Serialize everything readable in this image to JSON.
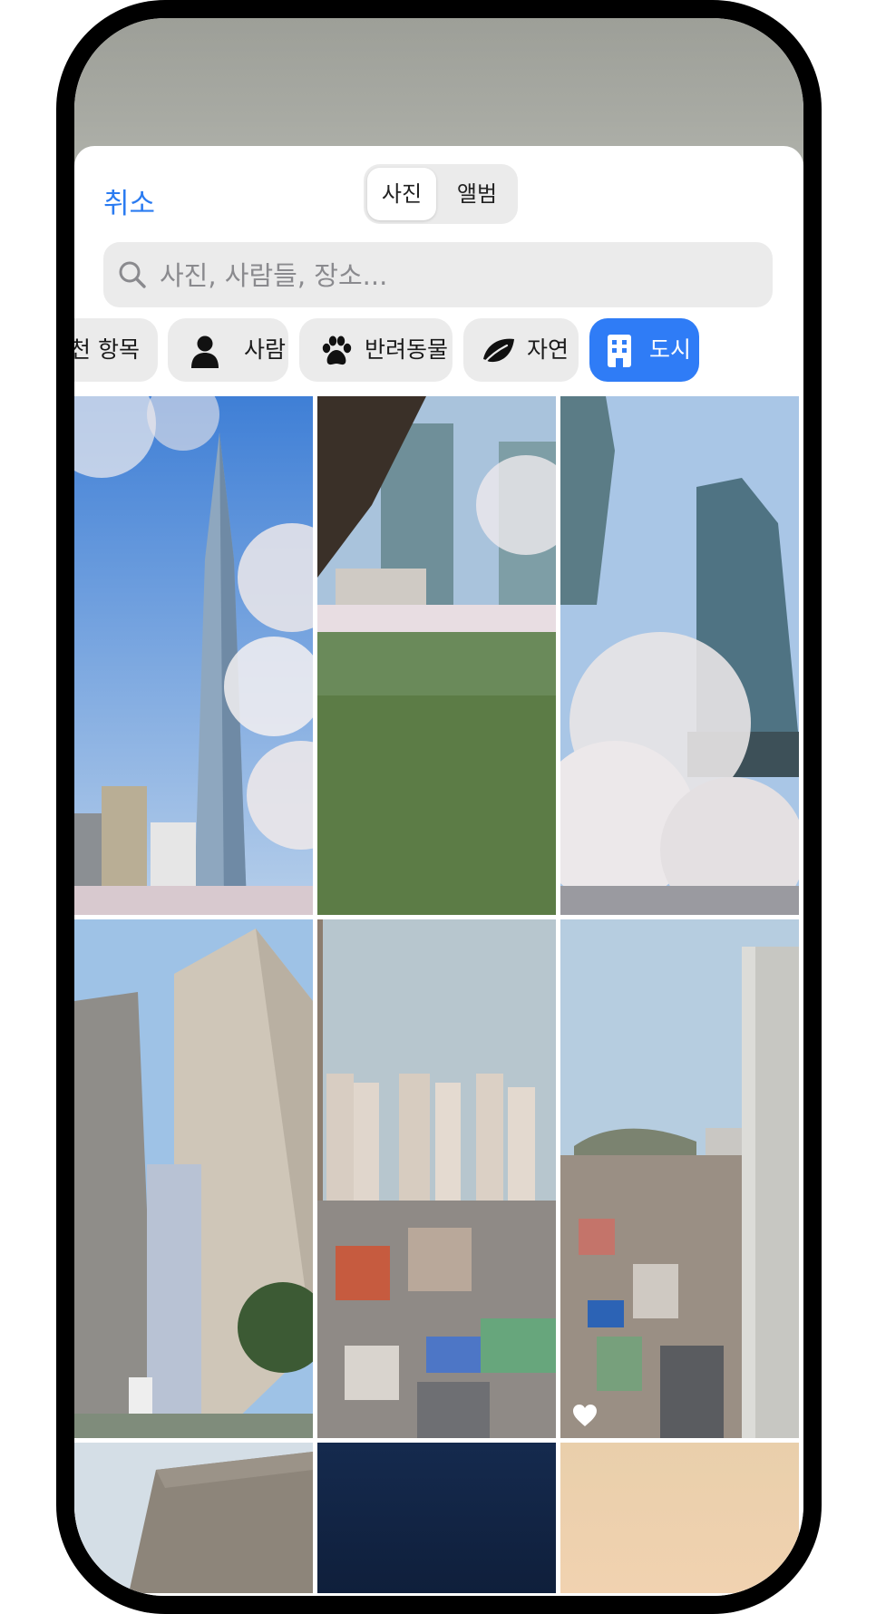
{
  "header": {
    "cancel_label": "취소",
    "segments": [
      "사진",
      "앨범"
    ]
  },
  "search": {
    "placeholder": "사진, 사람들, 장소..."
  },
  "categories": [
    {
      "label": "추천 항목",
      "icon": "",
      "selected": false
    },
    {
      "label": "사람",
      "icon": "person-icon",
      "selected": false
    },
    {
      "label": "반려동물",
      "icon": "paw-icon",
      "selected": false
    },
    {
      "label": "자연",
      "icon": "leaf-icon",
      "selected": false
    },
    {
      "label": "도시",
      "icon": "building-icon",
      "selected": true
    }
  ],
  "photos": [
    {
      "subject": "lotte-tower-cherry-blossoms"
    },
    {
      "subject": "lake-cherry-blossoms-towers"
    },
    {
      "subject": "glass-towers-cherry-blossoms"
    },
    {
      "subject": "apartment-towers-low-angle"
    },
    {
      "subject": "city-skyline-apartments"
    },
    {
      "subject": "dense-neighborhood-view",
      "favorite": true
    },
    {
      "subject": "building-corner-sky"
    },
    {
      "subject": "night-sky"
    },
    {
      "subject": "sunset-sky"
    }
  ],
  "colors": {
    "accent": "#2a7bf1",
    "chip_selected": "#2f7cf6",
    "chip_background": "#ebebeb"
  }
}
